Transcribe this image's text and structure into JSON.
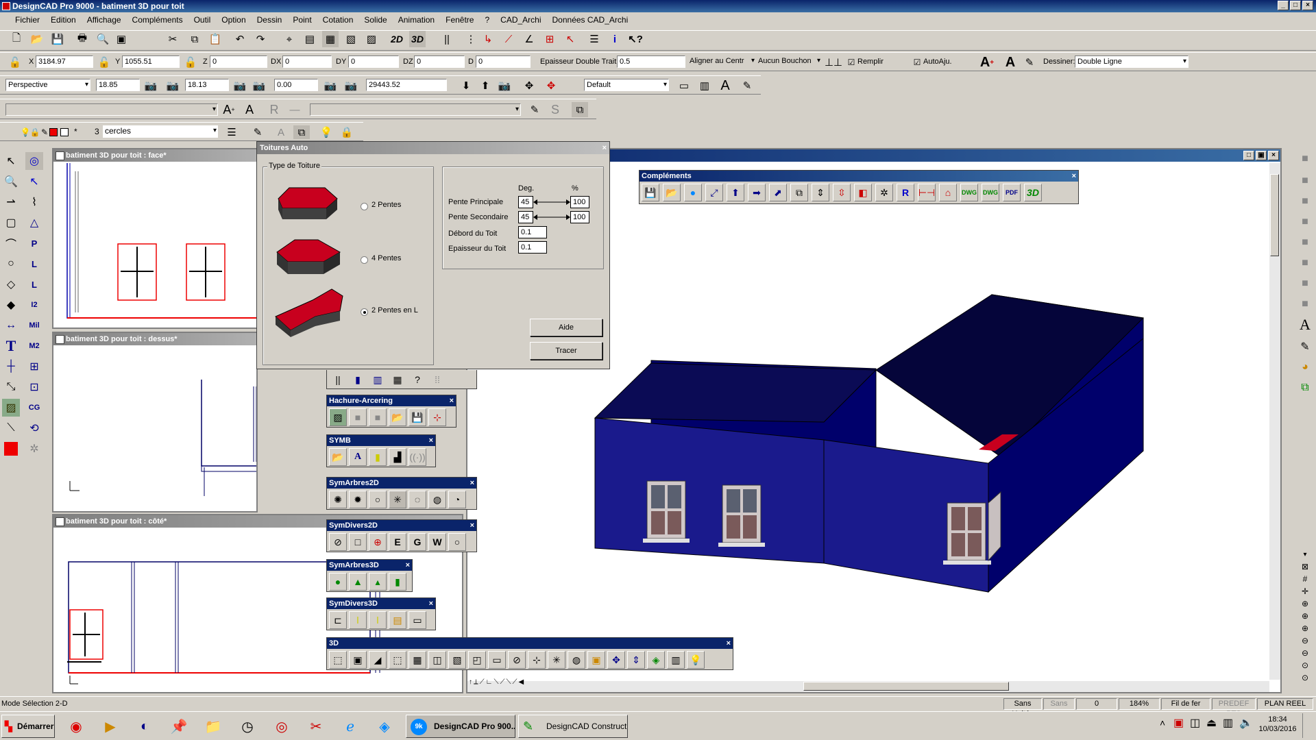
{
  "app": {
    "title": "DesignCAD Pro 9000 - batiment 3D pour toit"
  },
  "menu": [
    "Fichier",
    "Edition",
    "Affichage",
    "Compléments",
    "Outil",
    "Option",
    "Dessin",
    "Point",
    "Cotation",
    "Solide",
    "Animation",
    "Fenêtre",
    "?",
    "CAD_Archi",
    "Données CAD_Archi"
  ],
  "coords": {
    "x_label": "X",
    "x": "3184.97",
    "y_label": "Y",
    "y": "1055.51",
    "z_label": "Z",
    "z": "0",
    "dx_label": "DX",
    "dx": "0",
    "dy_label": "DY",
    "dy": "0",
    "dz_label": "DZ",
    "dz": "0",
    "d_label": "D",
    "d": "0",
    "epaisseur_label": "Epaisseur Double Trait",
    "epaisseur": "0.5",
    "aligner": "Aligner au Centr",
    "bouchon": "Aucun Bouchon",
    "remplir": "Remplir",
    "autoaju": "AutoAju.",
    "dessiner_label": "Dessiner:",
    "dessiner": "Double Ligne"
  },
  "view": {
    "projection": "Perspective",
    "v1": "18.85",
    "v2": "18.13",
    "v3": "0.00",
    "v4": "29443.52",
    "style": "Default"
  },
  "layer": {
    "star": "*",
    "count": "3",
    "name": "cercles"
  },
  "windows": {
    "face": "batiment 3D pour toit : face*",
    "dessus": "batiment 3D pour toit : dessus*",
    "cote": "batiment 3D pour toit : côté*"
  },
  "dialog": {
    "title": "Toitures Auto",
    "group_label": "Type de Toiture",
    "options": [
      "2 Pentes",
      "4 Pentes",
      "2 Pentes en L"
    ],
    "selected": 2,
    "col_deg": "Deg.",
    "col_pct": "%",
    "pente_principale_label": "Pente Principale",
    "pente_principale_deg": "45",
    "pente_principale_pct": "100",
    "pente_secondaire_label": "Pente Secondaire",
    "pente_secondaire_deg": "45",
    "pente_secondaire_pct": "100",
    "debord_label": "Débord du Toit",
    "debord": "0.1",
    "epaisseur_label": "Epaisseur du Toit",
    "epaisseur": "0.1",
    "aide": "Aide",
    "tracer": "Tracer"
  },
  "palettes": {
    "complements": "Compléments",
    "hachure": "Hachure-Arcering",
    "symb": "SYMB",
    "symarbres2d": "SymArbres2D",
    "symdivers2d": "SymDivers2D",
    "symarbres3d": "SymArbres3D",
    "symdivers3d": "SymDivers3D",
    "p3d": "3D",
    "complements_icons": {
      "r": "R",
      "dwg1": "DWG",
      "dwg2": "DWG",
      "pdf": "PDF",
      "three_d": "3D"
    },
    "symdivers2d_icons": {
      "e": "E",
      "g": "G",
      "w": "W"
    }
  },
  "lefttools": {
    "t": "T",
    "p": "P",
    "l1": "L",
    "l2": "L",
    "i2": "I2",
    "mil": "Mil",
    "m2": "M2",
    "cg": "CG",
    "s": "S"
  },
  "righttools": {
    "a": "A"
  },
  "status": {
    "mode": "Mode Sélection 2-D",
    "unites": "Sans Unités",
    "sans": "Sans",
    "val": "0",
    "zoom": "184%",
    "fil": "Fil de fer",
    "predef": "PREDEF PTS",
    "plan": "PLAN REEL"
  },
  "taskbar": {
    "start": "Démarrer",
    "task1": "DesignCAD Pro 900...",
    "task2": "DesignCAD Construct...",
    "time": "18:34",
    "date": "10/03/2016"
  },
  "colors": {
    "wall": "#00006b",
    "wall_light": "#1a1a8c",
    "roof_red": "#c8001e",
    "accent": "#0a246a"
  }
}
